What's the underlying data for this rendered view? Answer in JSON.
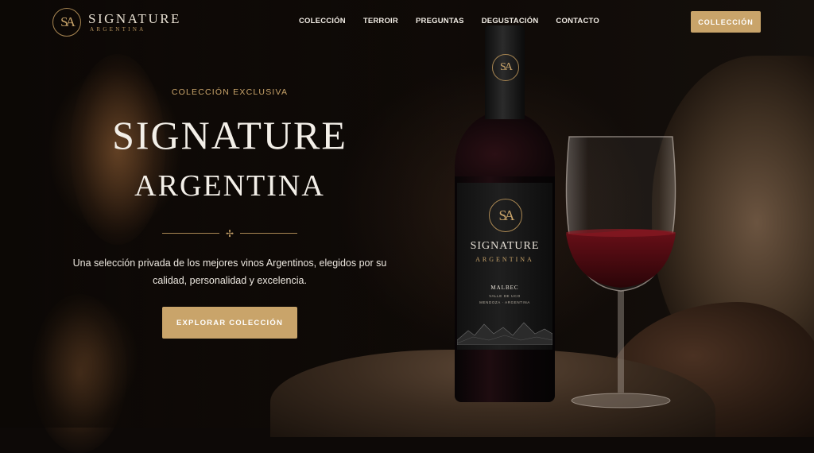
{
  "brand": {
    "monogram": "SA",
    "name": "SIGNATURE",
    "subname": "ARGENTINA"
  },
  "nav": {
    "links": [
      "COLECCIÓN",
      "TERROIR",
      "PREGUNTAS",
      "DEGUSTACIÓN",
      "CONTACTO"
    ],
    "button_label": "COLLECCIÓN"
  },
  "hero": {
    "eyebrow": "COLECCIÓN EXCLUSIVA",
    "title_line1": "SIGNATURE",
    "title_line2": "ARGENTINA",
    "ornament": "✢",
    "subtitle": "Una selección privada de los mejores vinos Argentinos, elegidos por su calidad, personalidad y excelencia.",
    "cta_label": "EXPLORAR COLECCIÓN"
  },
  "bottle": {
    "monogram": "SA",
    "label_title": "SIGNATURE",
    "label_sub": "ARGENTINA",
    "varietal": "MALBEC",
    "line1": "VALLE DE UCO",
    "line2": "MENDOZA · ARGENTINA"
  },
  "colors": {
    "accent": "#c9a46a",
    "background": "#0d0907",
    "text": "#f3efe8"
  }
}
